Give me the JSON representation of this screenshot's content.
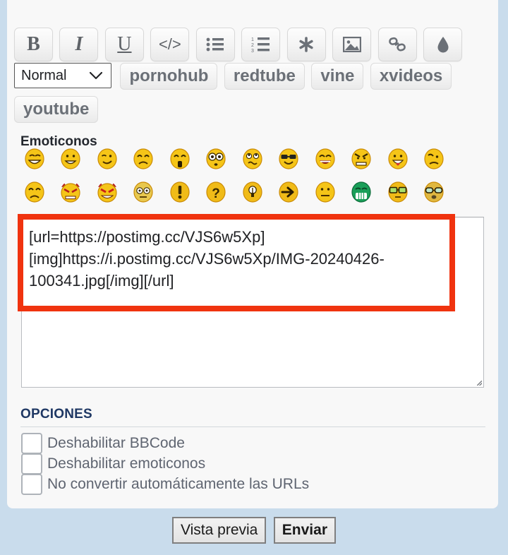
{
  "colors": {
    "page_background": "#c9dcec",
    "panel_background": "#f8f8f8",
    "annotation_red": "#f0330f",
    "options_heading": "#1f3864",
    "emoticons_heading": "#23272e",
    "label_text": "#5f6571"
  },
  "toolbar": {
    "buttons": [
      {
        "name": "bold-button",
        "label": "B",
        "icon": "bold-icon"
      },
      {
        "name": "italic-button",
        "label": "I",
        "icon": "italic-icon"
      },
      {
        "name": "underline-button",
        "label": "U",
        "icon": "underline-icon"
      },
      {
        "name": "code-button",
        "label": "</>",
        "icon": "code-icon"
      },
      {
        "name": "bullet-list-button",
        "label": "",
        "icon": "bullet-list-icon"
      },
      {
        "name": "numbered-list-button",
        "label": "",
        "icon": "numbered-list-icon"
      },
      {
        "name": "asterisk-button",
        "label": "",
        "icon": "asterisk-icon"
      },
      {
        "name": "image-button",
        "label": "",
        "icon": "image-icon"
      },
      {
        "name": "link-button",
        "label": "",
        "icon": "link-icon"
      },
      {
        "name": "color-button",
        "label": "",
        "icon": "water-drop-icon"
      }
    ]
  },
  "format_select": {
    "value": "Normal",
    "options": [
      "Normal"
    ]
  },
  "site_buttons": [
    {
      "name": "pornohub-button",
      "label": "pornohub"
    },
    {
      "name": "redtube-button",
      "label": "redtube"
    },
    {
      "name": "vine-button",
      "label": "vine"
    },
    {
      "name": "xvideos-button",
      "label": "xvideos"
    },
    {
      "name": "youtube-button",
      "label": "youtube"
    }
  ],
  "emoticons": {
    "heading": "Emoticonos",
    "row1": [
      "grin-icon",
      "smile-icon",
      "wink-icon",
      "worried-icon",
      "surprised-icon",
      "wide-eyes-icon",
      "rolling-eyes-icon",
      "cool-sunglasses-icon",
      "laugh-icon",
      "angry-icon",
      "tongue-out-icon",
      "sad-icon",
      "frown-icon",
      "devil-angry-icon"
    ],
    "row2": [
      "devil-grin-icon",
      "confused-icon",
      "exclamation-icon",
      "question-icon",
      "idea-lightbulb-icon",
      "arrow-right-icon",
      "neutral-icon",
      "green-grin-icon",
      "nerd-glasses-icon",
      "geek-glasses-icon"
    ]
  },
  "editor": {
    "value": "[url=https://postimg.cc/VJS6w5Xp]\n[img]https://i.postimg.cc/VJS6w5Xp/IMG-20240426-100341.jpg[/img][/url]",
    "placeholder": ""
  },
  "options": {
    "heading": "OPCIONES",
    "items": [
      {
        "name": "disable-bbcode-checkbox",
        "label": "Deshabilitar BBCode",
        "checked": false
      },
      {
        "name": "disable-emoticons-checkbox",
        "label": "Deshabilitar emoticonos",
        "checked": false
      },
      {
        "name": "no-auto-urls-checkbox",
        "label": "No convertir automáticamente las URLs",
        "checked": false
      }
    ]
  },
  "footer": {
    "preview_label": "Vista previa",
    "submit_label": "Enviar"
  }
}
